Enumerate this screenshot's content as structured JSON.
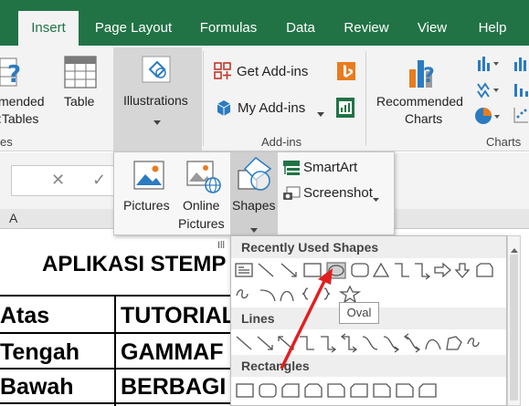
{
  "tabs": [
    "Insert",
    "Page Layout",
    "Formulas",
    "Data",
    "Review",
    "View",
    "Help"
  ],
  "ribbon": {
    "recommended_pivot_lines": [
      "mended",
      ":Tables"
    ],
    "table_label": "Table",
    "group_tables_fragment": "es",
    "illustrations_label": "Illustrations",
    "get_addins_label": "Get Add-ins",
    "my_addins_label": "My Add-ins",
    "addins_group": "Add-ins",
    "recommended_charts_lines": [
      "Recommended",
      "Charts"
    ],
    "charts_group": "Charts"
  },
  "formula_bar": {
    "cancel_glyph": "✕",
    "enter_glyph": "✓"
  },
  "column_header": "A",
  "illustrations_menu": {
    "pictures": "Pictures",
    "online_pictures_lines": [
      "Online",
      "Pictures"
    ],
    "shapes": "Shapes",
    "smartart": "SmartArt",
    "screenshot": "Screenshot",
    "group_fragment": "Ill"
  },
  "sheet": {
    "title_fragment": "APLIKASI STEMP",
    "rows": [
      {
        "a": "Atas",
        "b": "TUTORIAL"
      },
      {
        "a": "Tengah",
        "b": "GAMMAF"
      },
      {
        "a": "Bawah",
        "b": "BERBAGI T"
      }
    ]
  },
  "shapes_gallery": {
    "sections": [
      "Recently Used Shapes",
      "Lines",
      "Rectangles"
    ],
    "tooltip": "Oval"
  },
  "colors": {
    "tab_green": "#217346",
    "accent_blue": "#2b7bc1",
    "arrow_red": "#e02020",
    "addin_orange": "#e87c1e"
  }
}
